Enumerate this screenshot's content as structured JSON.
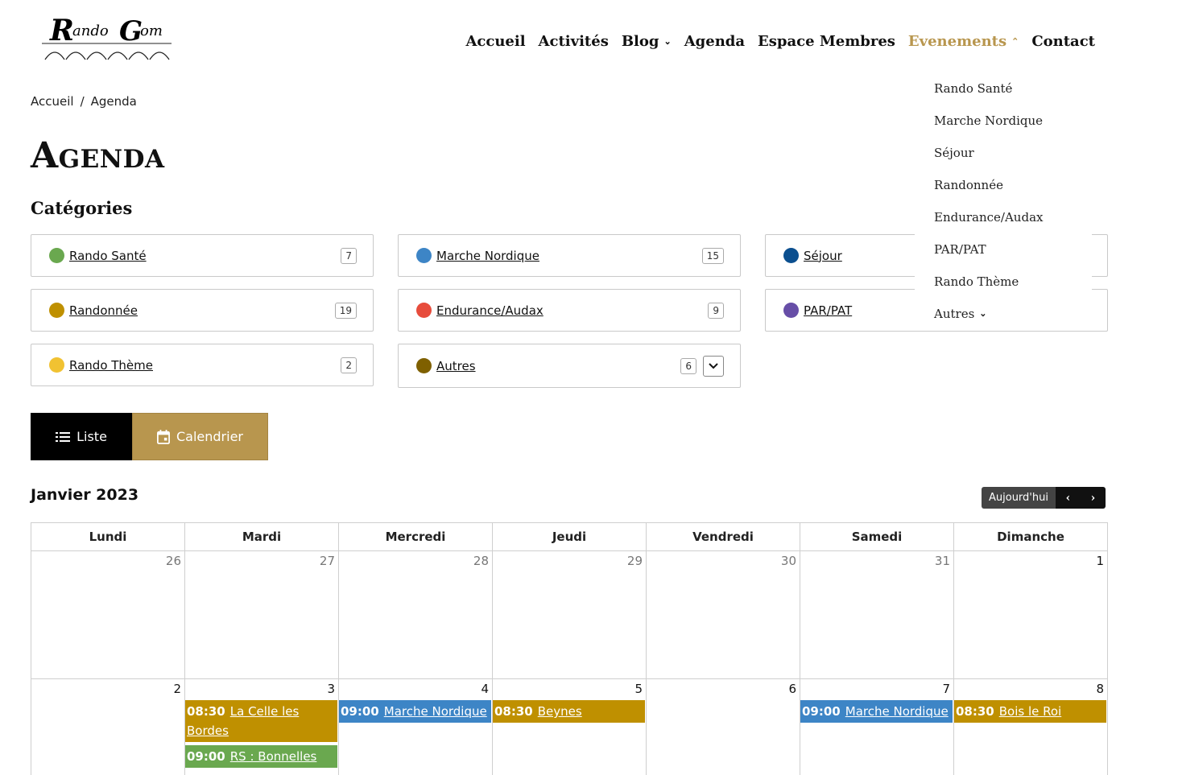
{
  "logo": {
    "text_part1": "ando",
    "text_part2": "om"
  },
  "nav": {
    "items": [
      {
        "label": "Accueil"
      },
      {
        "label": "Activités"
      },
      {
        "label": "Blog"
      },
      {
        "label": "Agenda"
      },
      {
        "label": "Espace Membres"
      },
      {
        "label": "Evenements"
      },
      {
        "label": "Contact"
      }
    ]
  },
  "dropdown": {
    "items": [
      {
        "label": "Rando Santé"
      },
      {
        "label": "Marche Nordique"
      },
      {
        "label": "Séjour"
      },
      {
        "label": "Randonnée"
      },
      {
        "label": "Endurance/Audax"
      },
      {
        "label": "PAR/PAT"
      },
      {
        "label": "Rando Thème"
      },
      {
        "label": "Autres"
      }
    ]
  },
  "breadcrumb": {
    "home": "Accueil",
    "separator": "/",
    "current": "Agenda"
  },
  "page_title": "Agenda",
  "categories_title": "Catégories",
  "categories": [
    {
      "label": "Rando Santé",
      "count": "7",
      "color": "#6aa84f"
    },
    {
      "label": "Marche Nordique",
      "count": "15",
      "color": "#3d85c6"
    },
    {
      "label": "Séjour",
      "count": "",
      "color": "#0b4f8f"
    },
    {
      "label": "Randonnée",
      "count": "19",
      "color": "#bf9000"
    },
    {
      "label": "Endurance/Audax",
      "count": "9",
      "color": "#e74c3c"
    },
    {
      "label": "PAR/PAT",
      "count": "",
      "color": "#674ea7"
    },
    {
      "label": "Rando Thème",
      "count": "2",
      "color": "#f1c232"
    },
    {
      "label": "Autres",
      "count": "6",
      "color": "#7f6000"
    }
  ],
  "view_toggle": {
    "list_label": "Liste",
    "calendar_label": "Calendrier"
  },
  "calendar": {
    "month_title": "Janvier 2023",
    "today_label": "Aujourd'hui",
    "weekdays": [
      "Lundi",
      "Mardi",
      "Mercredi",
      "Jeudi",
      "Vendredi",
      "Samedi",
      "Dimanche"
    ],
    "week1": [
      "26",
      "27",
      "28",
      "29",
      "30",
      "31",
      "1"
    ],
    "week2": [
      "2",
      "3",
      "4",
      "5",
      "6",
      "7",
      "8"
    ]
  },
  "events": {
    "tue": [
      {
        "time": "08:30",
        "title": "La Celle les Bordes",
        "color": "#bf9000"
      },
      {
        "time": "09:00",
        "title": "RS : Bonnelles",
        "color": "#6aa84f"
      }
    ],
    "wed": {
      "time": "09:00",
      "title": "Marche Nordique",
      "color": "#3d85c6"
    },
    "thu": {
      "time": "08:30",
      "title": "Beynes",
      "color": "#bf9000"
    },
    "sat": {
      "time": "09:00",
      "title": "Marche Nordique",
      "color": "#3d85c6"
    },
    "sun": {
      "time": "08:30",
      "title": "Bois le Roi",
      "color": "#bf9000"
    }
  }
}
